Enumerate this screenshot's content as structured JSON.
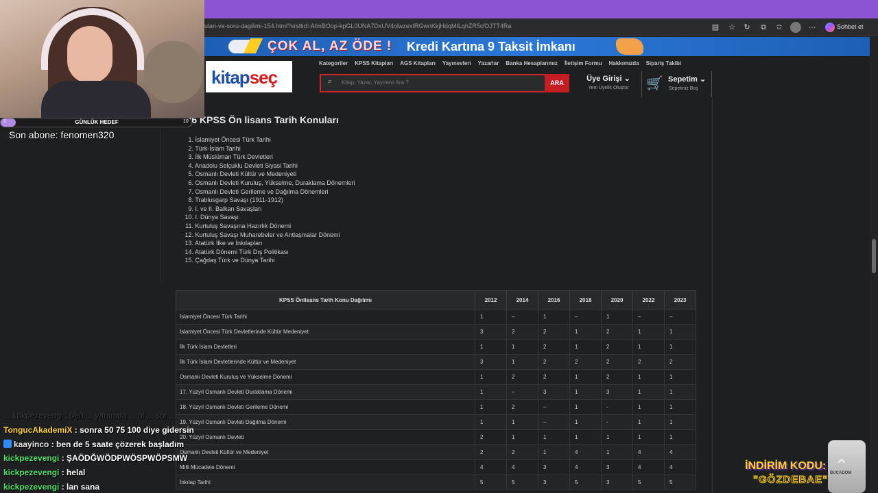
{
  "browser": {
    "url": "ulari-ve-soru-dagilimi-154.html?srsltid=AfmBOop-kpGL0UNA7DxUV4olwzexIRGwnKkjHdqMILqhZR5cfDJTT4Ra",
    "copilot_label": "Sohbet et"
  },
  "banner": {
    "left_text": "ÇOK AL, AZ ÖDE !",
    "right_text": "Kredi Kartına 9 Taksit İmkanı"
  },
  "header": {
    "logo_part1": "kitap",
    "logo_part2": "seç",
    "nav": [
      "Kategoriler",
      "KPSS Kitapları",
      "AGS Kitapları",
      "Yayınevleri",
      "Yazarlar",
      "Banka Hesaplarımız",
      "İletişim Formu",
      "Hakkımızda",
      "Sipariş Takibi"
    ],
    "search_placeholder": "Kitap, Yazar, Yayınevi Ara ?",
    "search_button": "ARA",
    "login_title": "Üye Girişi",
    "login_sub": "Yeni Üyelik Oluştur",
    "cart_title": "Sepetim",
    "cart_sub": "Sepetiniz Boş"
  },
  "main": {
    "heading": "2026 KPSS Ön lisans Tarih Konuları",
    "topics": [
      {
        "n": "1.",
        "t": "İslamiyet Öncesi Türk Tarihi"
      },
      {
        "n": "2.",
        "t": "Türk-İslam Tarihi"
      },
      {
        "n": "3.",
        "t": "İlk Müslüman Türk Devletleri"
      },
      {
        "n": "4.",
        "t": "Anadolu Selçuklu Devleti Siyasi Tarihi"
      },
      {
        "n": "5.",
        "t": "Osmanlı Devleti Kültür ve Medeniyeti"
      },
      {
        "n": "6.",
        "t": "Osmanlı Devleti Kuruluş, Yükselme, Duraklama Dönemleri"
      },
      {
        "n": "7.",
        "t": "Osmanlı Devleti Gerileme ve Dağılma Dönemleri"
      },
      {
        "n": "8.",
        "t": "Trablusgarp Savaşı (1911-1912)"
      },
      {
        "n": "9.",
        "t": "I. ve II. Balkan Savaşları"
      },
      {
        "n": "10.",
        "t": "I. Dünya Savaşı"
      },
      {
        "n": "11.",
        "t": "Kurtuluş Savaşına Hazırlık Dönemi"
      },
      {
        "n": "12.",
        "t": "Kurtuluş Savaşı Muharebeler ve Antlaşmalar Dönemi"
      },
      {
        "n": "13.",
        "t": "Atatürk İlke ve İnkılapları"
      },
      {
        "n": "14.",
        "t": "Atatürk Dönemi Türk Dış Politikası"
      },
      {
        "n": "15.",
        "t": "Çağdaş Türk ve Dünya Tarihi"
      }
    ],
    "table": {
      "header": "KPSS Önlisans Tarih Konu Dağılımı",
      "years": [
        "2012",
        "2014",
        "2016",
        "2018",
        "2020",
        "2022",
        "2023"
      ],
      "rows": [
        {
          "topic": "İslamiyet Öncesi Türk Tarihi",
          "v": [
            "1",
            "–",
            "1",
            "–",
            "1",
            "–",
            "–"
          ]
        },
        {
          "topic": "İslamiyet Öncesi Türk Devletlerinde Kültür Medeniyet",
          "v": [
            "3",
            "2",
            "2",
            "1",
            "2",
            "1",
            "1"
          ]
        },
        {
          "topic": "İlk Türk İslam Devletleri",
          "v": [
            "1",
            "1",
            "2",
            "1",
            "2",
            "1",
            "1"
          ]
        },
        {
          "topic": "İlk Türk İslam Devletlerinde Kültür ve Medeniyet",
          "v": [
            "3",
            "1",
            "2",
            "2",
            "2",
            "2",
            "2"
          ]
        },
        {
          "topic": "Osmanlı Devleti Kuruluş ve Yükselme Dönemi",
          "v": [
            "1",
            "2",
            "2",
            "1",
            "2",
            "1",
            "1"
          ]
        },
        {
          "topic": "17. Yüzyıl Osmanlı Devleti Duraklama Dönemi",
          "v": [
            "1",
            "–",
            "3",
            "1",
            "3",
            "1",
            "1"
          ]
        },
        {
          "topic": "18. Yüzyıl Osmanlı Devleti Gerileme Dönemi",
          "v": [
            "1",
            "2",
            "–",
            "1",
            "-",
            "1",
            "1"
          ]
        },
        {
          "topic": "19. Yüzyıl Osmanlı Devleti Dağılma Dönemi",
          "v": [
            "1",
            "1",
            "–",
            "1",
            "-",
            "1",
            "1"
          ]
        },
        {
          "topic": "20. Yüzyıl Osmanlı Devleti",
          "v": [
            "2",
            "1",
            "1",
            "1",
            "1",
            "1",
            "1"
          ]
        },
        {
          "topic": "Osmanlı Devleti Kültür ve Medeniyet",
          "v": [
            "2",
            "2",
            "1",
            "4",
            "1",
            "4",
            "4"
          ]
        },
        {
          "topic": "Milli Mücadele Dönemi",
          "v": [
            "4",
            "4",
            "3",
            "4",
            "3",
            "4",
            "4"
          ]
        },
        {
          "topic": "İnkılap Tarihi",
          "v": [
            "5",
            "5",
            "3",
            "5",
            "3",
            "5",
            "5"
          ]
        }
      ]
    }
  },
  "overlay": {
    "goal_label": "GÜNLÜK HEDEF",
    "goal_min": "1",
    "goal_max": "10",
    "goal_progress": 0.08,
    "last_sub": "Son abone: fenomen320",
    "chat_faded": "... kdkpezevengi : ben ... yanımda ... ol ... sor ...",
    "chat": [
      {
        "user": "TongucAkademiX",
        "text": " : sonra 50 75 100 diye gidersin",
        "cls": "u1",
        "badge": false
      },
      {
        "user": "kaayinco",
        "text": " : ben de 5 saate çözerek başladım",
        "cls": "u2",
        "badge": true
      },
      {
        "user": "kickpezevengi",
        "text": " : ŞAÖDĞWÖDPWÖSPWÖPSMW",
        "cls": "u3",
        "badge": false
      },
      {
        "user": "kickpezevengi",
        "text": " : helal",
        "cls": "u3",
        "badge": false
      },
      {
        "user": "kickpezevengi",
        "text": " : lan sana",
        "cls": "u3",
        "badge": false
      }
    ],
    "promo_line1": "İNDİRİM KODU:",
    "promo_line2": "\"GÖZDEBAE\"",
    "cup_label": "BUCADOM"
  }
}
